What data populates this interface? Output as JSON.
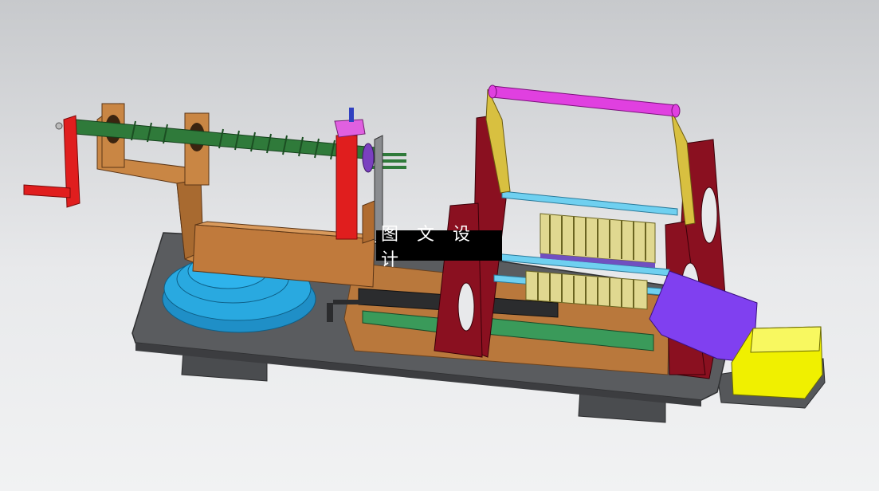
{
  "watermark": {
    "text": "图 文 设 计"
  },
  "colors": {
    "background_top": "#c7c9cc",
    "base_plate": "#55575a",
    "crank_red": "#e01e1e",
    "screw_green": "#2f7a3a",
    "bracket_copper": "#c07a3c",
    "turntable_blue": "#29a9e0",
    "frame_maroon": "#8a1020",
    "roller_magenta": "#e040e0",
    "motor_yellow": "#f0f000",
    "shaft_cyan": "#6fd0f0",
    "guide_green": "#3a9a5a",
    "chute_purple": "#8040f0"
  }
}
